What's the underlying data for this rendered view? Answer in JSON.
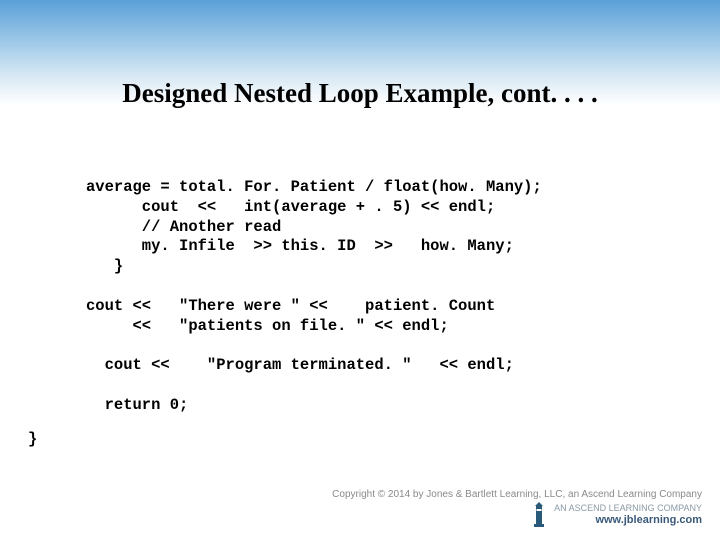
{
  "slide": {
    "title": "Designed Nested Loop Example, cont. . . .",
    "code_line1": "average = total. For. Patient / float(how. Many);",
    "code_line2": "      cout  <<   int(average + . 5) << endl;",
    "code_line3": "      // Another read",
    "code_line4": "      my. Infile  >> this. ID  >>   how. Many;",
    "code_line5": "   }",
    "code_blank1": "",
    "code_line6": "cout <<   \"There were \" <<    patient. Count",
    "code_line7": "     <<   \"patients on file. \" << endl;",
    "code_blank2": "",
    "code_line8": "  cout <<    \"Program terminated. \"   << endl;",
    "code_blank3": "",
    "code_line9": "  return 0;",
    "code_blank4": "",
    "code_line10": "}"
  },
  "footer": {
    "copyright": "Copyright © 2014 by Jones & Bartlett Learning, LLC, an Ascend Learning Company",
    "publisher_tag": "AN ASCEND LEARNING COMPANY",
    "publisher_url": "www.jblearning.com"
  }
}
